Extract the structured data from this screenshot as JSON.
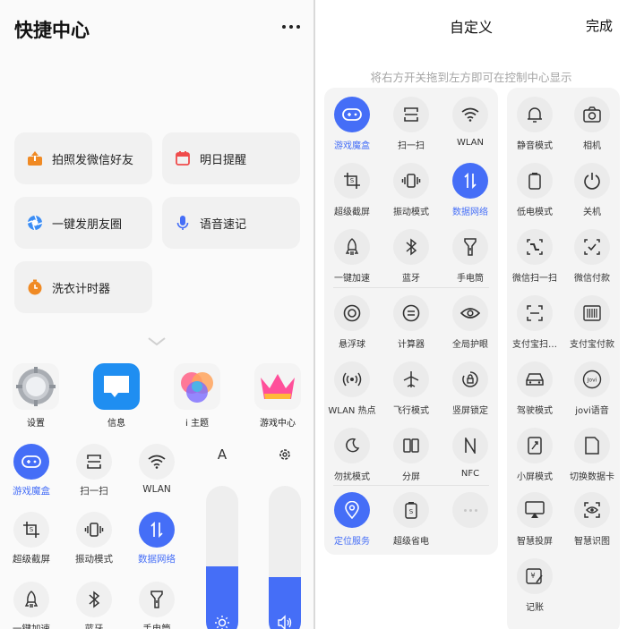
{
  "left": {
    "title": "快捷中心",
    "cards": [
      {
        "label": "拍照发微信好友",
        "icon": "share-upload-icon"
      },
      {
        "label": "明日提醒",
        "icon": "calendar-icon"
      },
      {
        "label": "一键发朋友圈",
        "icon": "moments-camera-icon"
      },
      {
        "label": "语音速记",
        "icon": "microphone-icon"
      },
      {
        "label": "洗衣计时器",
        "icon": "timer-icon"
      }
    ],
    "apps": [
      {
        "label": "设置",
        "icon": "settings-gear-icon"
      },
      {
        "label": "信息",
        "icon": "message-icon"
      },
      {
        "label": "i 主题",
        "icon": "theme-icon"
      },
      {
        "label": "游戏中心",
        "icon": "crown-icon"
      }
    ],
    "tiles": [
      {
        "label": "游戏魔盒",
        "active": true
      },
      {
        "label": "扫一扫",
        "active": false
      },
      {
        "label": "WLAN",
        "active": false
      },
      {
        "label": "超级截屏",
        "active": false
      },
      {
        "label": "振动模式",
        "active": false
      },
      {
        "label": "数据网络",
        "active": true
      },
      {
        "label": "一键加速",
        "active": false
      },
      {
        "label": "蓝牙",
        "active": false
      },
      {
        "label": "手电筒",
        "active": false
      }
    ],
    "auto_brightness_label": "A",
    "brightness_level": 0.47,
    "volume_level": 0.4
  },
  "right": {
    "title": "自定义",
    "done_label": "完成",
    "hint": "将右方开关拖到左方即可在控制中心显示",
    "active_tiles": [
      {
        "label": "游戏魔盒",
        "active": true
      },
      {
        "label": "扫一扫",
        "active": false
      },
      {
        "label": "WLAN",
        "active": false
      },
      {
        "label": "超级截屏",
        "active": false
      },
      {
        "label": "振动模式",
        "active": false
      },
      {
        "label": "数据网络",
        "active": true
      },
      {
        "label": "一键加速",
        "active": false
      },
      {
        "label": "蓝牙",
        "active": false
      },
      {
        "label": "手电筒",
        "active": false
      },
      {
        "label": "悬浮球",
        "active": false
      },
      {
        "label": "计算器",
        "active": false
      },
      {
        "label": "全局护眼",
        "active": false
      },
      {
        "label": "WLAN 热点",
        "active": false
      },
      {
        "label": "飞行模式",
        "active": false
      },
      {
        "label": "竖屏锁定",
        "active": false
      },
      {
        "label": "勿扰模式",
        "active": false
      },
      {
        "label": "分屏",
        "active": false
      },
      {
        "label": "NFC",
        "active": false
      },
      {
        "label": "定位服务",
        "active": true
      },
      {
        "label": "超级省电",
        "active": false
      }
    ],
    "available_tiles": [
      {
        "label": "静音模式"
      },
      {
        "label": "相机"
      },
      {
        "label": "低电模式"
      },
      {
        "label": "关机"
      },
      {
        "label": "微信扫一扫"
      },
      {
        "label": "微信付款"
      },
      {
        "label": "支付宝扫…"
      },
      {
        "label": "支付宝付款"
      },
      {
        "label": "驾驶模式"
      },
      {
        "label": "jovi语音"
      },
      {
        "label": "小屏模式"
      },
      {
        "label": "切换数据卡"
      },
      {
        "label": "智慧投屏"
      },
      {
        "label": "智慧识图"
      },
      {
        "label": "记账"
      }
    ]
  },
  "colors": {
    "accent": "#456ef7",
    "tile_bg": "#f0f0f0",
    "orange": "#f08a24",
    "red": "#ef4b4b"
  }
}
